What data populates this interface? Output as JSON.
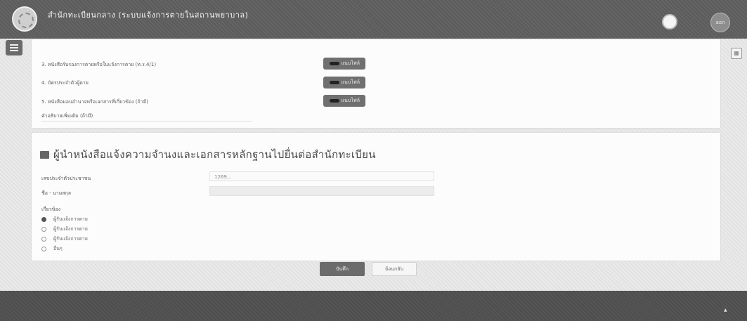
{
  "header": {
    "title": "สำนักทะเบียนกลาง (ระบบแจ้งการตายในสถานพยาบาล)",
    "subtitle": "",
    "user_label": "ออก",
    "breadcrumb": ""
  },
  "documents": {
    "rows": [
      {
        "label": "3. หนังสือรับรองการตายหรือใบแจ้งการตาย (ท.ร.4/1)",
        "button": "แนบไฟล์"
      },
      {
        "label": "4. บัตรประจำตัวผู้ตาย",
        "button": "แนบไฟล์"
      },
      {
        "label": "5. หนังสือมอบอำนาจหรือเอกสารที่เกี่ยวข้อง (ถ้ามี)",
        "button": "แนบไฟล์"
      }
    ],
    "note_label": "คำอธิบายเพิ่มเติม (ถ้ามี)"
  },
  "reporter": {
    "title": "ผู้นำหนังสือแจ้งความจำนงและเอกสารหลักฐานไปยื่นต่อสำนักทะเบียน",
    "fields": [
      {
        "label": "เลขประจำตัวประชาชน",
        "value": "1269..."
      },
      {
        "label": "ชื่อ - นามสกุล",
        "value": ""
      }
    ],
    "relation_label": "เกี่ยวข้อง",
    "options": [
      {
        "label": "ผู้รับแจ้งการตาย",
        "selected": true
      },
      {
        "label": "ผู้รับแจ้งการตาย",
        "selected": false
      },
      {
        "label": "ผู้รับแจ้งการตาย",
        "selected": false
      },
      {
        "label": "อื่นๆ",
        "selected": false
      }
    ]
  },
  "actions": {
    "save": "บันทึก",
    "cancel": "ย้อนกลับ"
  },
  "footer": {
    "contact": "",
    "copyright": ""
  }
}
